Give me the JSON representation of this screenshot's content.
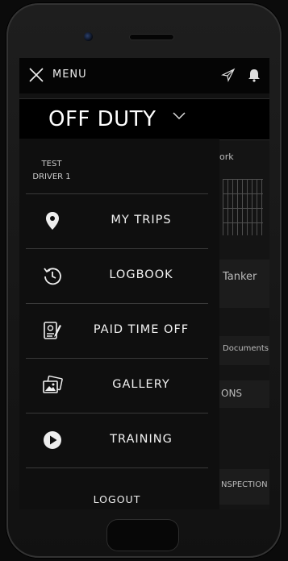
{
  "header": {
    "menu_label": "MENU"
  },
  "status": {
    "duty": "OFF DUTY"
  },
  "driver": {
    "line1": "TEST",
    "line2": "DRIVER 1"
  },
  "menu": {
    "items": [
      {
        "label": "MY TRIPS",
        "icon": "location-pin-icon"
      },
      {
        "label": "LOGBOOK",
        "icon": "history-clock-icon"
      },
      {
        "label": "PAID TIME OFF",
        "icon": "document-edit-icon"
      },
      {
        "label": "GALLERY",
        "icon": "photos-icon"
      },
      {
        "label": "TRAINING",
        "icon": "play-circle-icon"
      }
    ],
    "logout": "LOGOUT"
  },
  "background": {
    "work": "ork",
    "tanker": "Tanker",
    "documents": "Documents",
    "ons": "ONS",
    "inspection": "NSPECTION"
  }
}
